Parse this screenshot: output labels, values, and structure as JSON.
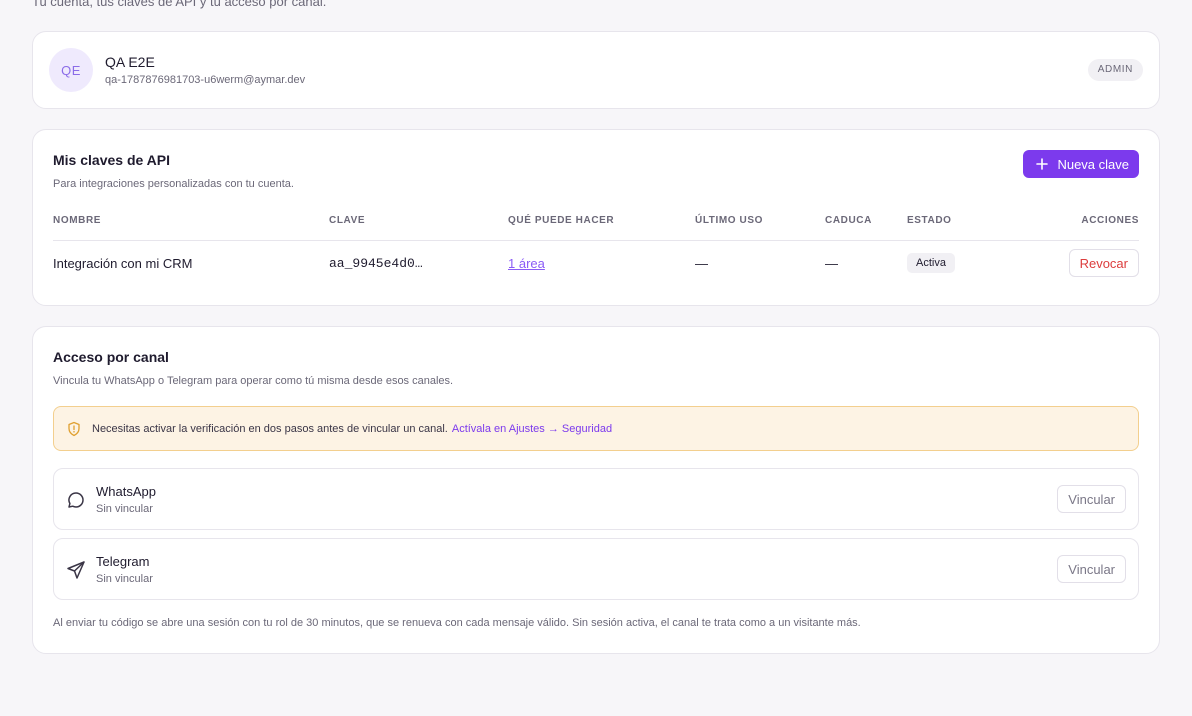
{
  "page": {
    "subtitle": "Tu cuenta, tus claves de API y tu acceso por canal."
  },
  "profile": {
    "initials": "QE",
    "name": "QA E2E",
    "email": "qa-1787876981703-u6werm@aymar.dev",
    "role": "ADMIN"
  },
  "api_keys": {
    "title": "Mis claves de API",
    "description": "Para integraciones personalizadas con tu cuenta.",
    "new_key_label": "Nueva clave",
    "columns": [
      "Nombre",
      "Clave",
      "Qué puede hacer",
      "Último uso",
      "Caduca",
      "Estado",
      "Acciones"
    ],
    "rows": [
      {
        "name": "Integración con mi CRM",
        "key": "aa_9945e4d0…",
        "scope": "1 área",
        "last_used": "—",
        "expires": "—",
        "status": "Activa",
        "action": "Revocar"
      }
    ]
  },
  "channels": {
    "title": "Acceso por canal",
    "description": "Vincula tu WhatsApp o Telegram para operar como tú misma desde esos canales.",
    "warning_text": "Necesitas activar la verificación en dos pasos antes de vincular un canal.",
    "warning_link": "Actívala en Ajustes → Seguridad",
    "items": [
      {
        "name": "WhatsApp",
        "status": "Sin vincular",
        "action": "Vincular",
        "icon": "message-circle-icon"
      },
      {
        "name": "Telegram",
        "status": "Sin vincular",
        "action": "Vincular",
        "icon": "send-icon"
      }
    ],
    "footnote": "Al enviar tu código se abre una sesión con tu rol de 30 minutos, que se renueva con cada mensaje válido. Sin sesión activa, el canal te trata como a un visitante más."
  },
  "colors": {
    "accent": "#7c3aed",
    "danger": "#dc3d3d",
    "warning_bg": "#fdf3e4",
    "warning_border": "#f3cf8e"
  }
}
